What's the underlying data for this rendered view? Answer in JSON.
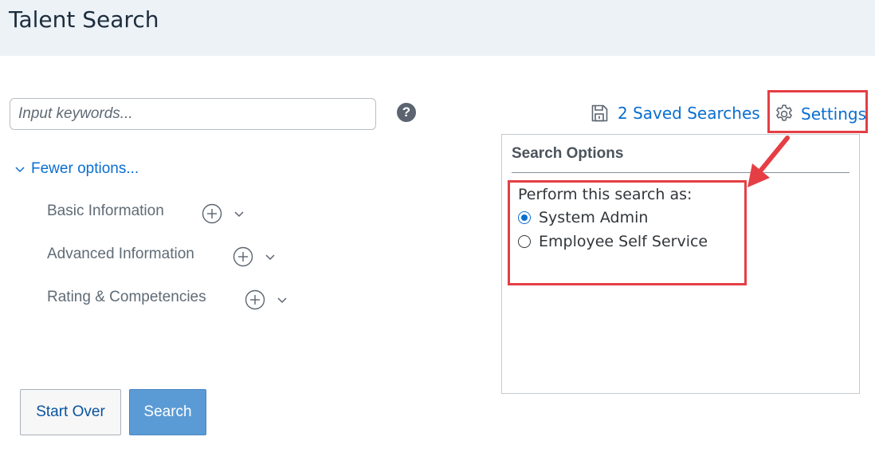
{
  "header": {
    "title": "Talent Search"
  },
  "search": {
    "placeholder": "Input keywords...",
    "value": ""
  },
  "help": {
    "glyph": "?"
  },
  "toolbar": {
    "saved_searches_label": "2 Saved Searches",
    "settings_label": "Settings"
  },
  "search_options": {
    "title": "Search Options",
    "perform_as_label": "Perform this search as:",
    "options": [
      {
        "label": "System Admin",
        "selected": true
      },
      {
        "label": "Employee Self Service",
        "selected": false
      }
    ]
  },
  "filters": {
    "toggle_label": "Fewer options...",
    "sections": [
      {
        "label": "Basic Information"
      },
      {
        "label": "Advanced Information"
      },
      {
        "label": "Rating & Competencies"
      }
    ]
  },
  "actions": {
    "start_over_label": "Start Over",
    "search_label": "Search"
  },
  "colors": {
    "accent": "#0a6ed1",
    "highlight": "#e53e44",
    "primary_button": "#5b9bd5",
    "header_bg": "#edf2f7"
  }
}
